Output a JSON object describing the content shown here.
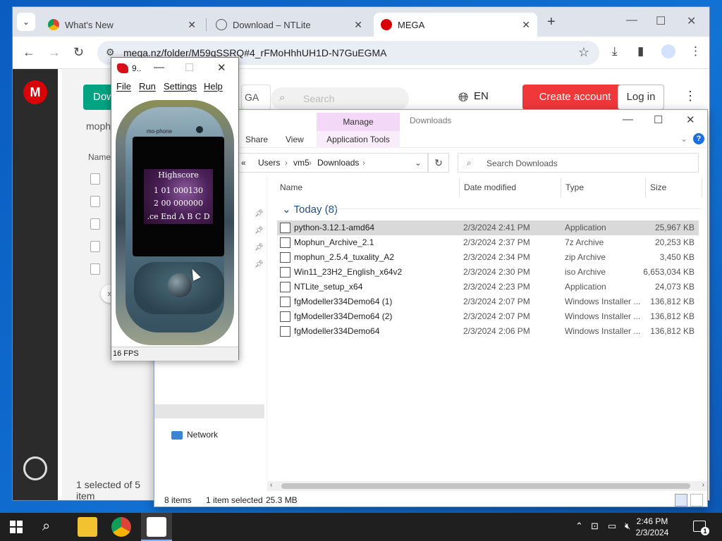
{
  "chrome": {
    "tabs": [
      {
        "title": "What's New"
      },
      {
        "title": "Download – NTLite"
      },
      {
        "title": "MEGA"
      }
    ],
    "url": "mega.nz/folder/M59qSSRQ#4_rFMoHhhUH1D-N7GuEGMA"
  },
  "mega": {
    "download_button": "Dow",
    "folder_crumb": "mophun",
    "column_name": "Name",
    "mega_button": "GA",
    "search_placeholder": "Search",
    "language": "EN",
    "create_account": "Create account",
    "login": "Log in",
    "status": "1 selected of 5 item"
  },
  "explorer": {
    "title": "Downloads",
    "manage_tab": "Manage",
    "ribbon": [
      "Share",
      "View",
      "Application Tools"
    ],
    "breadcrumb": [
      "«",
      "Users",
      "vm5",
      "Downloads"
    ],
    "search_placeholder": "Search Downloads",
    "columns": [
      "Name",
      "Date modified",
      "Type",
      "Size"
    ],
    "group": "Today (8)",
    "nav_network": "Network",
    "files": [
      {
        "name": "python-3.12.1-amd64",
        "date": "2/3/2024 2:41 PM",
        "type": "Application",
        "size": "25,967 KB",
        "selected": true
      },
      {
        "name": "Mophun_Archive_2.1",
        "date": "2/3/2024 2:37 PM",
        "type": "7z Archive",
        "size": "20,253 KB"
      },
      {
        "name": "mophun_2.5.4_tuxality_A2",
        "date": "2/3/2024 2:34 PM",
        "type": "zip Archive",
        "size": "3,450 KB"
      },
      {
        "name": "Win11_23H2_English_x64v2",
        "date": "2/3/2024 2:30 PM",
        "type": "iso Archive",
        "size": "6,653,034 KB"
      },
      {
        "name": "NTLite_setup_x64",
        "date": "2/3/2024 2:23 PM",
        "type": "Application",
        "size": "24,073 KB"
      },
      {
        "name": "fgModeller334Demo64 (1)",
        "date": "2/3/2024 2:07 PM",
        "type": "Windows Installer ...",
        "size": "136,812 KB"
      },
      {
        "name": "fgModeller334Demo64 (2)",
        "date": "2/3/2024 2:07 PM",
        "type": "Windows Installer ...",
        "size": "136,812 KB"
      },
      {
        "name": "fgModeller334Demo64",
        "date": "2/3/2024 2:06 PM",
        "type": "Windows Installer ...",
        "size": "136,812 KB"
      }
    ],
    "status_items": "8 items",
    "status_selected": "1 item selected",
    "status_size": "25.3 MB"
  },
  "emulator": {
    "title": "9..",
    "menu": [
      "File",
      "Run",
      "Settings",
      "Help"
    ],
    "phone_brand": "mo-phone",
    "game_lines": [
      "Highscore",
      "1    01 000130",
      "2    00 000000",
      ".ce End A B C D"
    ],
    "fps": "16 FPS"
  },
  "taskbar": {
    "time": "2:46 PM",
    "date": "2/3/2024",
    "notifications": "1"
  },
  "colors": {
    "mega_red": "#d90007",
    "mega_green": "#00a382",
    "create_account": "#f0373a",
    "manage_tab": "#f3d8f8",
    "selected_row": "#d9d9d9"
  }
}
